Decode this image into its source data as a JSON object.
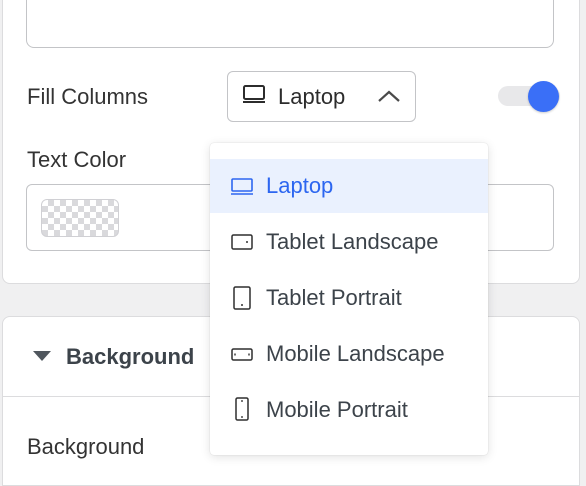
{
  "fill_columns": {
    "label": "Fill Columns",
    "selected_device": "Laptop",
    "toggle_on": true
  },
  "text_color": {
    "label": "Text Color"
  },
  "background_section": {
    "title": "Background",
    "field_label": "Background"
  },
  "device_dropdown": {
    "items": [
      {
        "label": "Laptop",
        "icon": "laptop-icon",
        "active": true
      },
      {
        "label": "Tablet Landscape",
        "icon": "tablet-landscape-icon",
        "active": false
      },
      {
        "label": "Tablet Portrait",
        "icon": "tablet-portrait-icon",
        "active": false
      },
      {
        "label": "Mobile Landscape",
        "icon": "mobile-landscape-icon",
        "active": false
      },
      {
        "label": "Mobile Portrait",
        "icon": "mobile-portrait-icon",
        "active": false
      }
    ]
  },
  "colors": {
    "accent": "#3a6ff7",
    "active_item_bg": "#eaf1fe",
    "active_item_text": "#2c66f0"
  }
}
